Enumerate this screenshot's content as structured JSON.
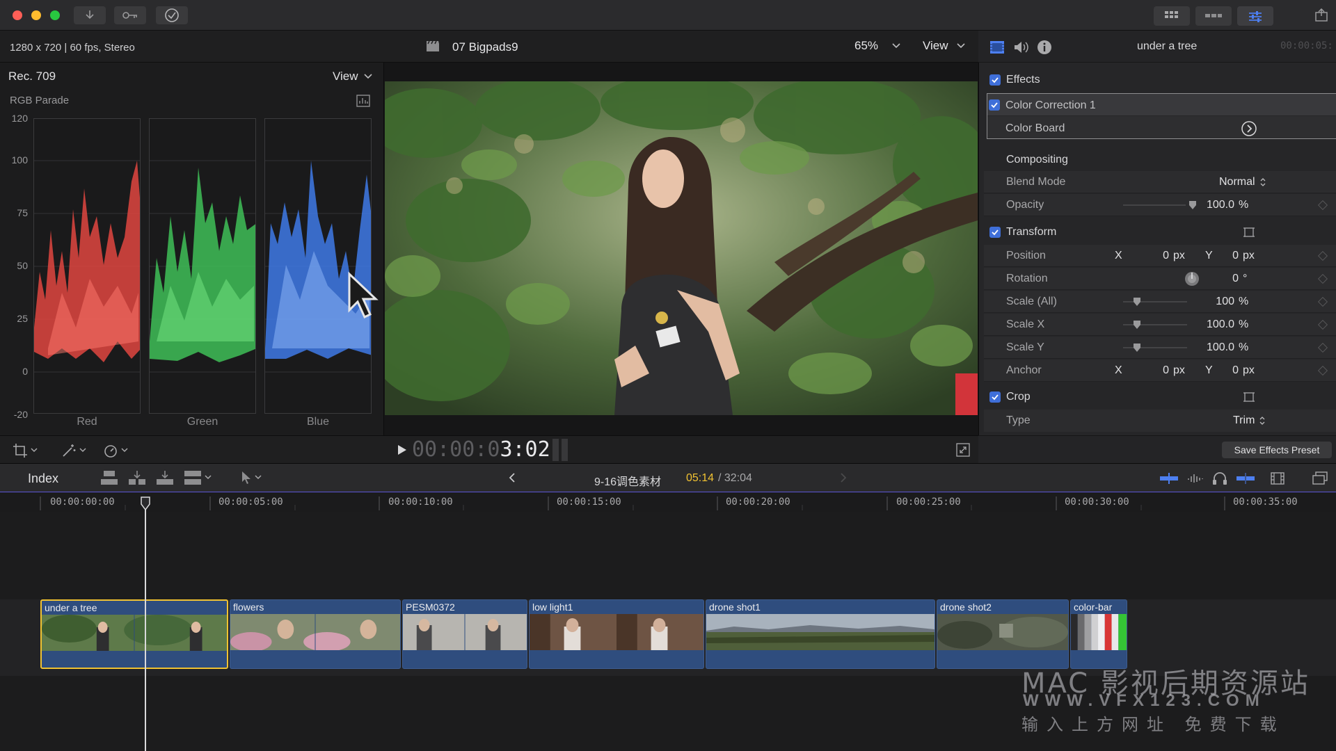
{
  "window": {
    "format": "1280 x 720 | 60 fps, Stereo",
    "project_name": "07 Bigpads9",
    "zoom": "65%",
    "view_label": "View"
  },
  "scope": {
    "color_space": "Rec. 709",
    "view_label": "View",
    "type": "RGB Parade",
    "y_labels": [
      "120",
      "100",
      "75",
      "50",
      "25",
      "0",
      "-20"
    ],
    "channels": [
      "Red",
      "Green",
      "Blue"
    ]
  },
  "inspector": {
    "clip_title": "under a tree",
    "clip_timecode": "00:00:05:",
    "effects_label": "Effects",
    "color_correction_label": "Color Correction 1",
    "color_board_label": "Color Board",
    "compositing_label": "Compositing",
    "blend_mode_label": "Blend Mode",
    "blend_mode_value": "Normal",
    "opacity_label": "Opacity",
    "opacity_value": "100.0",
    "opacity_unit": "%",
    "transform_label": "Transform",
    "position_label": "Position",
    "x_label": "X",
    "y_label": "Y",
    "position_x": "0",
    "position_y": "0",
    "px_unit": "px",
    "rotation_label": "Rotation",
    "rotation_value": "0",
    "degree_unit": "°",
    "scale_all_label": "Scale (All)",
    "scale_all_value": "100",
    "scale_x_label": "Scale X",
    "scale_x_value": "100.0",
    "scale_y_label": "Scale Y",
    "scale_y_value": "100.0",
    "percent_unit": "%",
    "anchor_label": "Anchor",
    "anchor_x": "0",
    "anchor_y": "0",
    "crop_label": "Crop",
    "type_label": "Type",
    "type_value": "Trim",
    "save_preset_label": "Save Effects Preset"
  },
  "viewer": {
    "timecode_dim": "00:00:0",
    "timecode_bright": "3:02"
  },
  "timeline": {
    "index_label": "Index",
    "project_name": "9-16调色素材",
    "current_time": "05:14",
    "total_time": "/ 32:04",
    "ruler": [
      "00:00:00:00",
      "00:00:05:00",
      "00:00:10:00",
      "00:00:15:00",
      "00:00:20:00",
      "00:00:25:00",
      "00:00:30:00",
      "00:00:35:00"
    ],
    "clips": [
      {
        "name": "under a tree",
        "selected": true
      },
      {
        "name": "flowers"
      },
      {
        "name": "PESM0372"
      },
      {
        "name": "low light1"
      },
      {
        "name": "drone shot1"
      },
      {
        "name": "drone shot2"
      },
      {
        "name": "color-bar"
      }
    ]
  },
  "watermark": {
    "line1": "MAC 影视后期资源站",
    "line2": "WWW.VFX123.COM",
    "line3": "输入上方网址 免费下载"
  },
  "colors": {
    "accent": "#3f6fd9",
    "selection": "#f1c232",
    "clip": "#2f4d7e",
    "current_time": "#f1c232"
  }
}
